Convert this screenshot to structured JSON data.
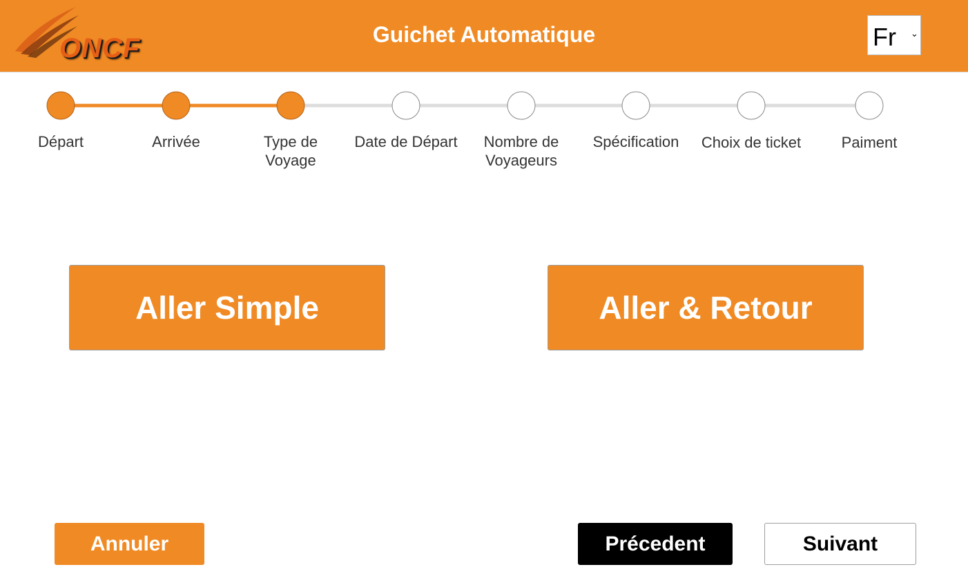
{
  "header": {
    "logo_text": "ONCF",
    "title": "Guichet Automatique",
    "language": {
      "selected": "Fr"
    }
  },
  "stepper": {
    "current_step": 3,
    "steps": [
      {
        "label": "Départ",
        "completed": true
      },
      {
        "label": "Arrivée",
        "completed": true
      },
      {
        "label": "Type de Voyage",
        "completed": true
      },
      {
        "label": "Date de Départ",
        "completed": false
      },
      {
        "label": "Nombre de Voyageurs",
        "completed": false
      },
      {
        "label": "Spécification",
        "completed": false
      },
      {
        "label": "Choix de ticket",
        "completed": false
      },
      {
        "label": "Paiment",
        "completed": false
      }
    ]
  },
  "options": {
    "one_way": "Aller Simple",
    "round_trip": "Aller & Retour"
  },
  "footer": {
    "cancel": "Annuler",
    "previous": "Précedent",
    "next": "Suivant"
  },
  "colors": {
    "accent": "#f08a24",
    "inactive_line": "#dddddd",
    "dark": "#000000"
  }
}
